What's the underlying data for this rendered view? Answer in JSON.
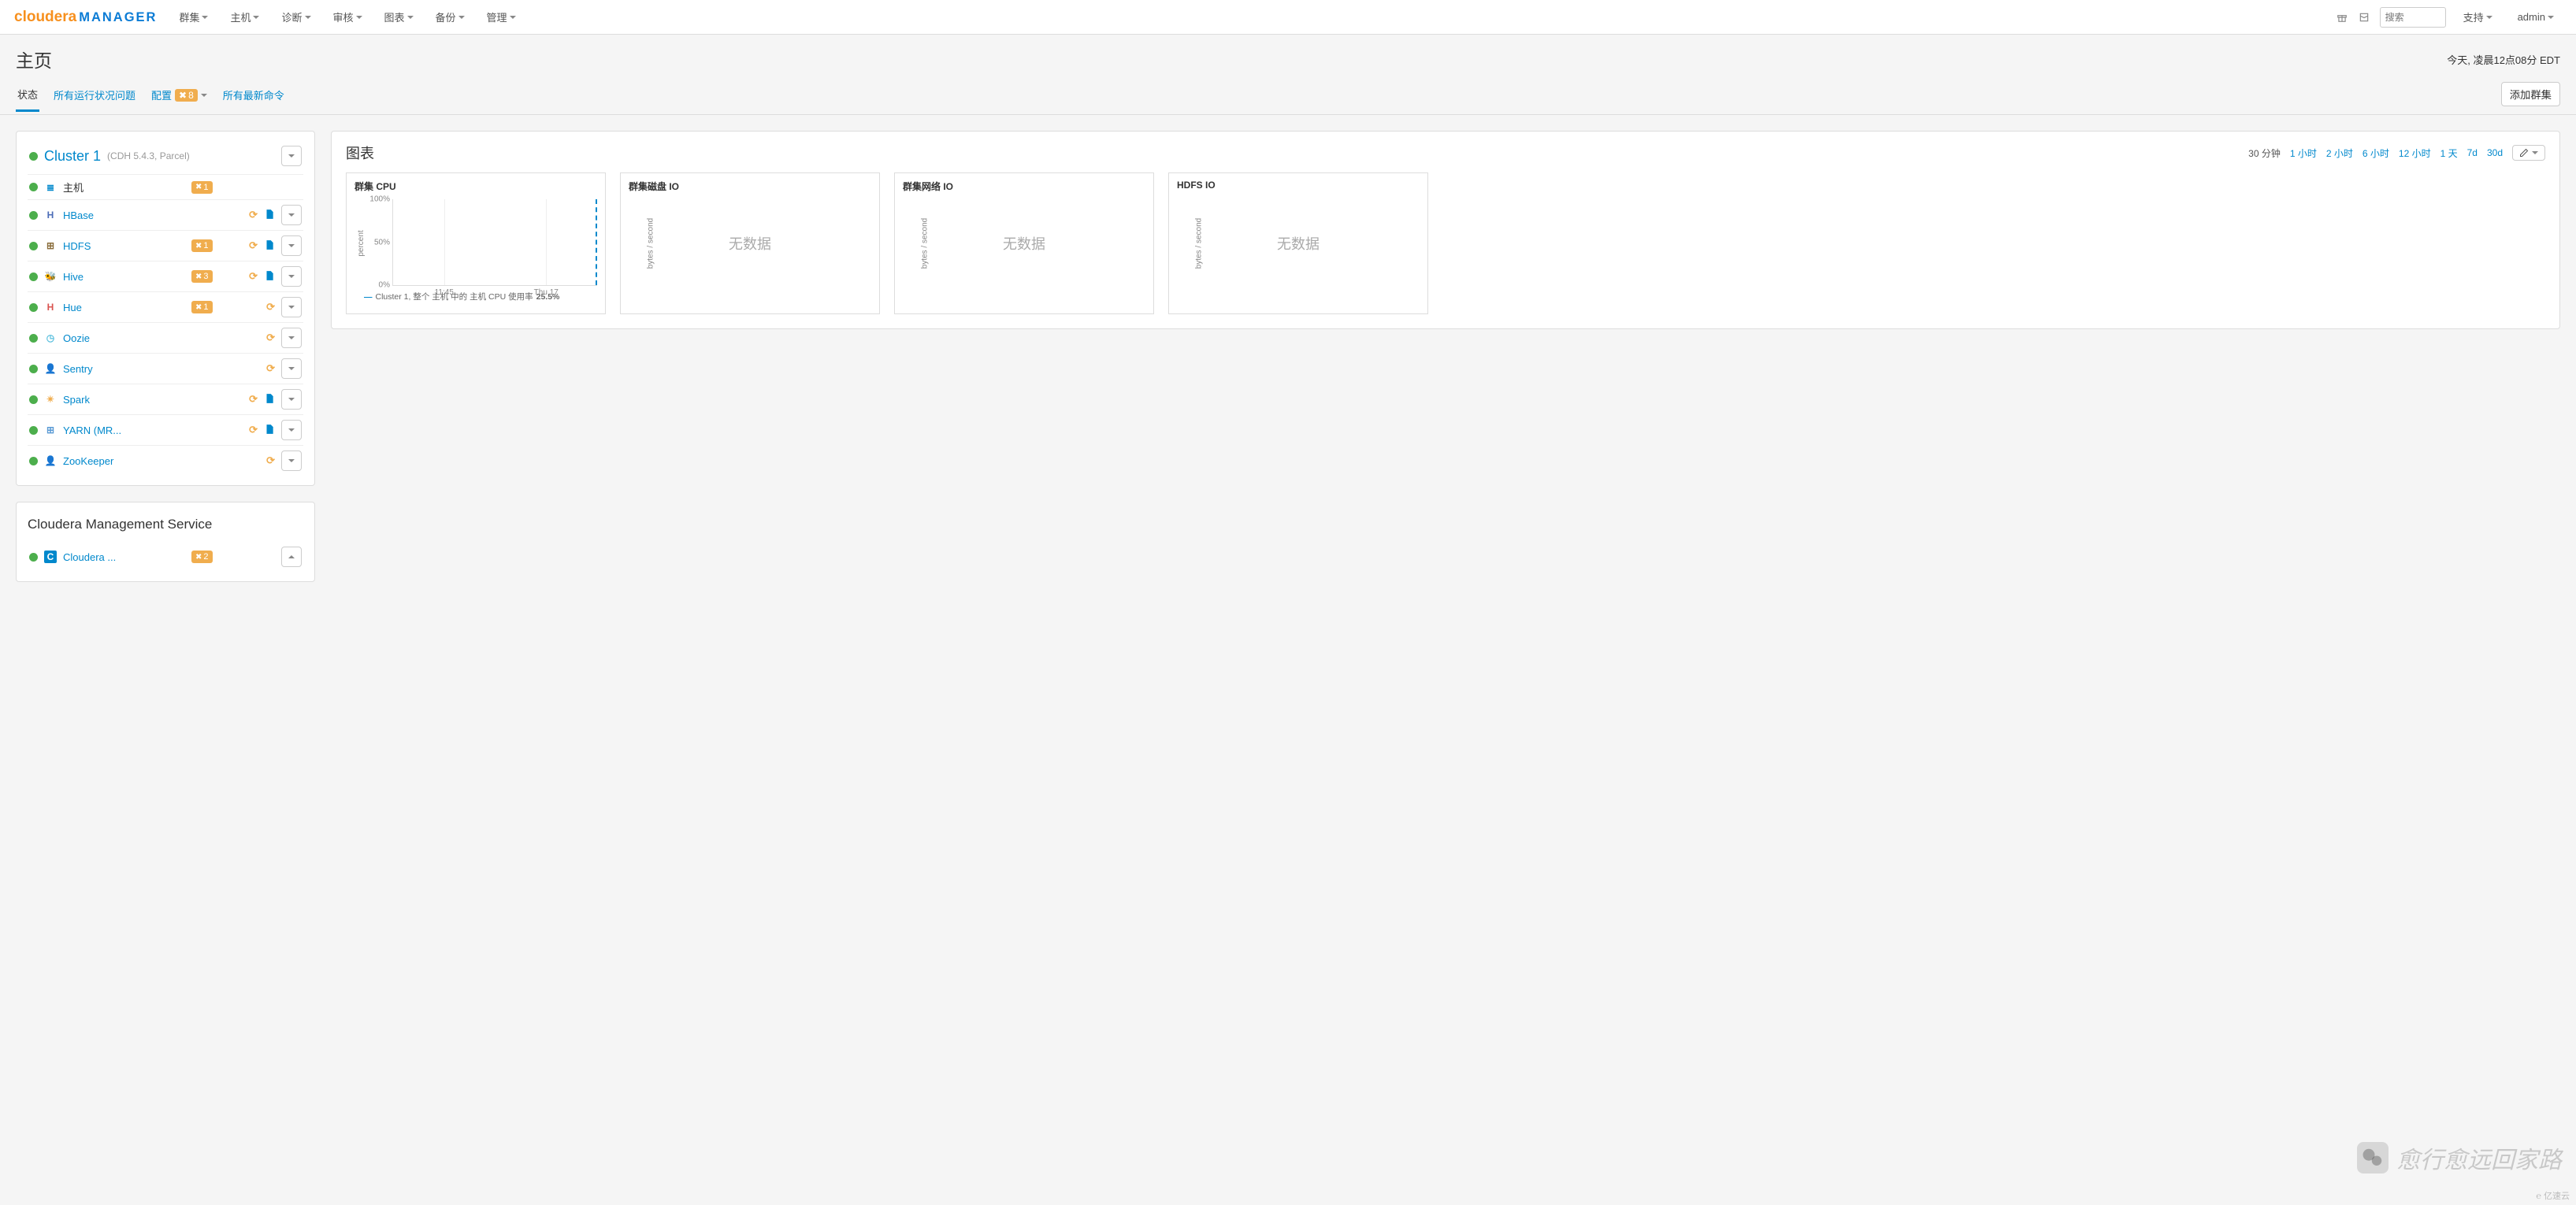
{
  "brand": {
    "a": "cloudera",
    "b": "MANAGER"
  },
  "nav": {
    "items": [
      "群集",
      "主机",
      "诊断",
      "审核",
      "图表",
      "备份",
      "管理"
    ],
    "search_placeholder": "搜索",
    "support": "支持",
    "user": "admin"
  },
  "page": {
    "title": "主页",
    "timestamp": "今天, 凌晨12点08分 EDT"
  },
  "tabs": {
    "status": "状态",
    "health": "所有运行状况问题",
    "config": "配置",
    "config_count": "8",
    "commands": "所有最新命令",
    "add_cluster": "添加群集"
  },
  "cluster": {
    "name": "Cluster 1",
    "version": "(CDH 5.4.3, Parcel)",
    "host_label": "主机",
    "services": [
      {
        "icon": "≣",
        "icon_color": "#0088cc",
        "name": "主机",
        "warn": "1",
        "restart": false,
        "config": false,
        "dd": false,
        "dark": true
      },
      {
        "icon": "H",
        "icon_color": "#4b6cb7",
        "name": "HBase",
        "warn": "",
        "restart": true,
        "config": true,
        "dd": true
      },
      {
        "icon": "⊞",
        "icon_color": "#8a6d3b",
        "name": "HDFS",
        "warn": "1",
        "restart": true,
        "config": true,
        "dd": true
      },
      {
        "icon": "🐝",
        "icon_color": "#f0ad4e",
        "name": "Hive",
        "warn": "3",
        "restart": true,
        "config": true,
        "dd": true
      },
      {
        "icon": "H",
        "icon_color": "#d9534f",
        "name": "Hue",
        "warn": "1",
        "restart": true,
        "config": false,
        "dd": true
      },
      {
        "icon": "◷",
        "icon_color": "#5bc0de",
        "name": "Oozie",
        "warn": "",
        "restart": true,
        "config": false,
        "dd": true
      },
      {
        "icon": "👤",
        "icon_color": "#5bc0de",
        "name": "Sentry",
        "warn": "",
        "restart": true,
        "config": false,
        "dd": true
      },
      {
        "icon": "✴",
        "icon_color": "#f0ad4e",
        "name": "Spark",
        "warn": "",
        "restart": true,
        "config": true,
        "dd": true
      },
      {
        "icon": "⊞",
        "icon_color": "#5b9bd5",
        "name": "YARN (MR...",
        "warn": "",
        "restart": true,
        "config": true,
        "dd": true
      },
      {
        "icon": "👤",
        "icon_color": "#8a6d3b",
        "name": "ZooKeeper",
        "warn": "",
        "restart": true,
        "config": false,
        "dd": true
      }
    ]
  },
  "mgmt": {
    "title": "Cloudera Management Service",
    "svc": {
      "icon": "C",
      "icon_bg": "#0088cc",
      "name": "Cloudera ...",
      "warn": "2"
    }
  },
  "charts": {
    "title": "图表",
    "ranges": [
      "30 分钟",
      "1 小时",
      "2 小时",
      "6 小时",
      "12 小时",
      "1 天",
      "7d",
      "30d"
    ],
    "active_range_idx": 0,
    "cards": [
      {
        "title": "群集 CPU",
        "type": "cpu"
      },
      {
        "title": "群集磁盘 IO",
        "type": "nodata",
        "ylab": "bytes / second"
      },
      {
        "title": "群集网络 IO",
        "type": "nodata",
        "ylab": "bytes / second"
      },
      {
        "title": "HDFS IO",
        "type": "nodata",
        "ylab": "bytes / second"
      }
    ],
    "no_data": "无数据",
    "cpu": {
      "ylab": "percent",
      "legend": "Cluster 1, 整个 主机 中的 主机 CPU 使用率",
      "value": "25.5%"
    }
  },
  "chart_data": {
    "type": "line",
    "title": "群集 CPU",
    "xlabel": "",
    "ylabel": "percent",
    "ylim": [
      0,
      100
    ],
    "y_ticks": [
      0,
      50,
      100
    ],
    "x_ticks": [
      "11:45",
      "Thu 17"
    ],
    "series": [
      {
        "name": "Cluster 1, 整个 主机 中的 主机 CPU 使用率",
        "values": [
          25.5
        ]
      }
    ]
  },
  "watermark": "愈行愈远回家路",
  "footer": "亿速云"
}
